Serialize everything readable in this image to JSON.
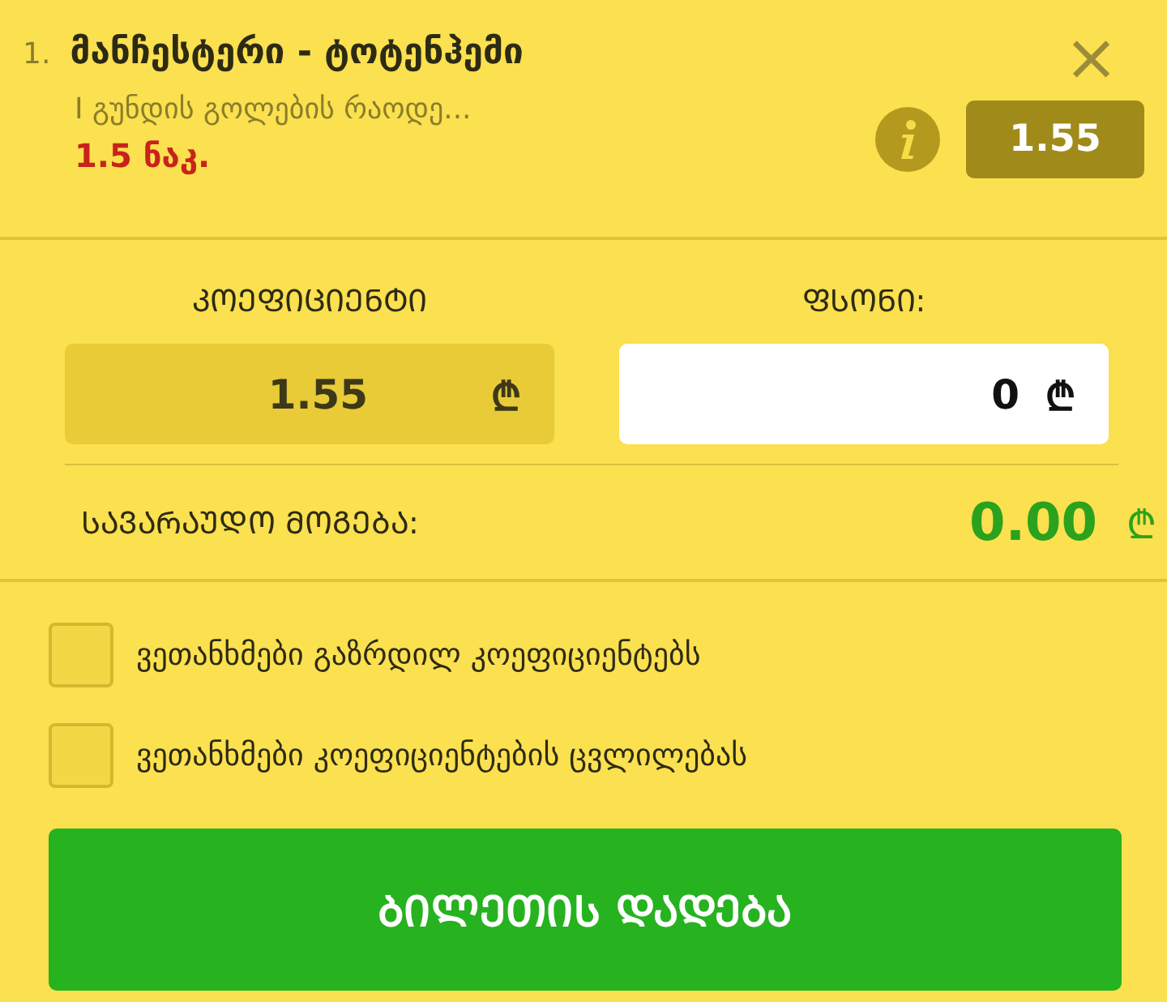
{
  "bet": {
    "number": "1.",
    "title": "მანჩესტერი - ტოტენჰემი",
    "market": "I გუნდის გოლების რაოდე...",
    "selection": "1.5 ნაკ.",
    "odds": "1.55",
    "close": "×"
  },
  "odds_field": {
    "label": "ᲙᲝᲔᲤᲘᲪᲘᲔᲜᲢᲘ",
    "value": "1.55",
    "currency": "₾",
    "disabled": true
  },
  "stake_field": {
    "label": "ᲤᲡᲝᲜᲘ:",
    "value": "0",
    "currency": "₾",
    "disabled": false
  },
  "potential_win": {
    "label": "ᲡᲐᲕᲐᲠᲐᲣᲓᲝ ᲛᲝᲒᲔᲑᲐ:",
    "value": "0.00",
    "currency": "₾"
  },
  "options": [
    {
      "label": "ვეთანხმები გაზრდილ კოეფიციენტებს",
      "checked": false
    },
    {
      "label": "ვეთანხმები კოეფიციენტების ცვლილებას",
      "checked": false
    }
  ],
  "submit": "ᲑᲘᲚᲔᲗᲘᲡ ᲓᲐᲓᲔᲑᲐ"
}
